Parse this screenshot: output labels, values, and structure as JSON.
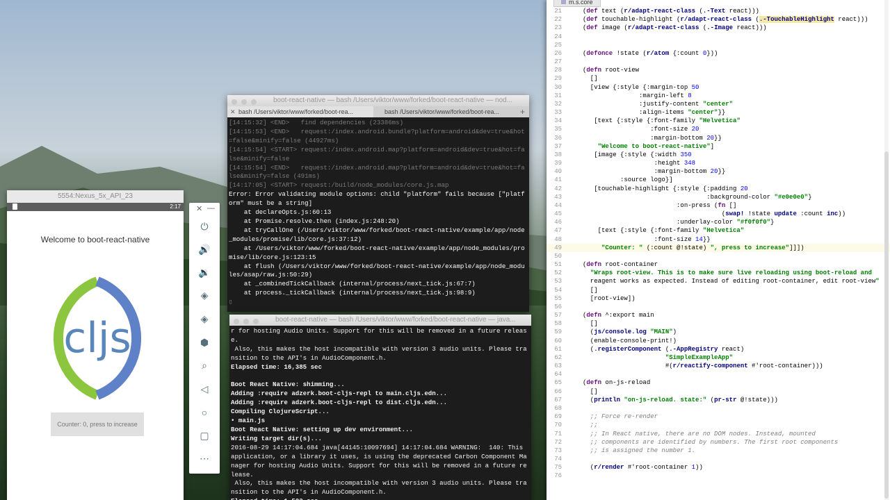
{
  "emulator": {
    "window_title": "5554:Nexus_5x_API_23",
    "status_time": "2:17",
    "welcome_text": "Welcome to boot-react-native",
    "logo_text": "cljs",
    "counter_button": "Counter: 0, press to increase",
    "logo_colors": {
      "green": "#8cc63f",
      "blue": "#5e81c7",
      "text": "#5a87bb"
    }
  },
  "emulator_toolbar": {
    "close": "✕",
    "minimize": "—",
    "icons": [
      "power-icon",
      "volume-up-icon",
      "volume-down-icon",
      "rotate-left-icon",
      "rotate-right-icon",
      "camera-icon",
      "zoom-icon",
      "back-icon",
      "home-icon",
      "overview-icon",
      "more-icon"
    ],
    "glyphs": [
      "⏻",
      "🔊",
      "🔉",
      "◈",
      "◈",
      "⬢",
      "⌕",
      "◁",
      "○",
      "▢",
      "⋯"
    ]
  },
  "terminal1": {
    "title": "boot-react-native — bash  /Users/viktor/www/forked/boot-react-native — nod...",
    "tabs": [
      "bash  /Users/viktor/www/forked/boot-rea...",
      "bash  /Users/viktor/www/forked/boot-rea..."
    ],
    "lines": [
      {
        "text": "[14:15:32] <END>   find dependencies (23386ms)",
        "cls": ""
      },
      {
        "text": "[14:15:53] <END>   request:/index.android.bundle?platform=android&dev=true&hot=false&minify=false (44927ms)",
        "cls": ""
      },
      {
        "text": "[14:15:54] <START> request:/index.android.map?platform=android&dev=true&hot=false&minify=false",
        "cls": ""
      },
      {
        "text": "[14:15:54] <END>   request:/index.android.map?platform=android&dev=true&hot=false&minify=false (491ms)",
        "cls": ""
      },
      {
        "text": "[14:17:05] <START> request:/build/node_modules/core.js.map",
        "cls": ""
      },
      {
        "text": "Error: Error validating module options: child \"platform\" fails because [\"platform\" must be a string]",
        "cls": "err"
      },
      {
        "text": "    at declareOpts.js:60:13",
        "cls": "err"
      },
      {
        "text": "    at Promise.resolve.then (index.js:248:20)",
        "cls": "err"
      },
      {
        "text": "    at tryCallOne (/Users/viktor/www/forked/boot-react-native/example/app/node_modules/promise/lib/core.js:37:12)",
        "cls": "err"
      },
      {
        "text": "    at /Users/viktor/www/forked/boot-react-native/example/app/node_modules/promise/lib/core.js:123:15",
        "cls": "err"
      },
      {
        "text": "    at flush (/Users/viktor/www/forked/boot-react-native/example/app/node_modules/asap/raw.js:50:29)",
        "cls": "err"
      },
      {
        "text": "    at _combinedTickCallback (internal/process/next_tick.js:67:7)",
        "cls": "err"
      },
      {
        "text": "    at process._tickCallback (internal/process/next_tick.js:98:9)",
        "cls": "err"
      },
      {
        "text": "▯",
        "cls": ""
      }
    ]
  },
  "terminal2": {
    "title": "boot-react-native — bash  /Users/viktor/www/forked/boot-react-native — java...",
    "lines": [
      {
        "text": "r for hosting Audio Units. Support for this will be removed in a future release.",
        "cls": "nb"
      },
      {
        "text": " Also, this makes the host incompatible with version 3 audio units. Please transition to the API's in AudioComponent.h.",
        "cls": "nb"
      },
      {
        "text": "Elapsed time: 16,385 sec",
        "cls": ""
      },
      {
        "text": " ",
        "cls": ""
      },
      {
        "text": "Boot React Native: shimming...",
        "cls": ""
      },
      {
        "text": "Adding :require adzerk.boot-cljs-repl to main.cljs.edn...",
        "cls": ""
      },
      {
        "text": "Adding :require adzerk.boot-cljs-repl to dist.cljs.edn...",
        "cls": ""
      },
      {
        "text": "Compiling ClojureScript...",
        "cls": ""
      },
      {
        "text": "• main.js",
        "cls": ""
      },
      {
        "text": "Boot React Native: setting up dev environment...",
        "cls": ""
      },
      {
        "text": "Writing target dir(s)...",
        "cls": ""
      },
      {
        "text": "2016-08-29 14:17:04.684 java[44145:10097694] 14:17:04.684 WARNING:  140: This application, or a library it uses, is using the deprecated Carbon Component Manager for hosting Audio Units. Support for this will be removed in a future release.",
        "cls": "nb"
      },
      {
        "text": " Also, this makes the host incompatible with version 3 audio units. Please transition to the API's in AudioComponent.h.",
        "cls": "nb"
      },
      {
        "text": "Elapsed time: 1,523 sec",
        "cls": ""
      }
    ]
  },
  "editor": {
    "tab": "m.s.core",
    "lines": [
      {
        "n": "21",
        "h": "(def text (r/adapt-react-class (.-Text react)))"
      },
      {
        "n": "22",
        "h": "(def touchable-highlight (r/adapt-react-class (.-TouchableHighlight react)))"
      },
      {
        "n": "23",
        "h": "(def image (r/adapt-react-class (.-Image react)))"
      },
      {
        "n": "24",
        "h": ""
      },
      {
        "n": "25",
        "h": ""
      },
      {
        "n": "26",
        "h": "(defonce !state (r/atom {:count 0}))"
      },
      {
        "n": "27",
        "h": ""
      },
      {
        "n": "28",
        "h": "(defn root-view"
      },
      {
        "n": "29",
        "h": "  []"
      },
      {
        "n": "30",
        "h": "  [view {:style {:margin-top 50"
      },
      {
        "n": "31",
        "h": "               :margin-left 8"
      },
      {
        "n": "32",
        "h": "               :justify-content \"center\""
      },
      {
        "n": "33",
        "h": "               :align-items \"center\"}}"
      },
      {
        "n": "34",
        "h": "   [text {:style {:font-family \"Helvetica\""
      },
      {
        "n": "35",
        "h": "                  :font-size 20"
      },
      {
        "n": "36",
        "h": "                  :margin-bottom 20}}"
      },
      {
        "n": "37",
        "h": "    \"Welcome to boot-react-native\"]"
      },
      {
        "n": "38",
        "h": "   [image {:style {:width 350"
      },
      {
        "n": "39",
        "h": "                   :height 348"
      },
      {
        "n": "40",
        "h": "                   :margin-bottom 20}}"
      },
      {
        "n": "41",
        "h": "          :source logo}]"
      },
      {
        "n": "42",
        "h": "   [touchable-highlight {:style {:padding 20"
      },
      {
        "n": "43",
        "h": "                                 :background-color \"#e0e0e0\"}"
      },
      {
        "n": "44",
        "h": "                         :on-press (fn []"
      },
      {
        "n": "45",
        "h": "                                     (swap! !state update :count inc))"
      },
      {
        "n": "46",
        "h": "                         :underlay-color \"#f0f0f0\"}"
      },
      {
        "n": "47",
        "h": "    [text {:style {:font-family \"Helvetica\""
      },
      {
        "n": "48",
        "h": "                   :font-size 14}}"
      },
      {
        "n": "49",
        "h": "     \"Counter: \" (:count @!state) \", press to increase\"]]])"
      },
      {
        "n": "50",
        "h": ""
      },
      {
        "n": "51",
        "h": "(defn root-container"
      },
      {
        "n": "52",
        "h": "  \"Wraps root-view. This is to make sure live reloading using boot-reload and"
      },
      {
        "n": "53",
        "h": "  reagent works as expected. Instead of editing root-container, edit root-view\""
      },
      {
        "n": "54",
        "h": "  []"
      },
      {
        "n": "55",
        "h": "  [root-view])"
      },
      {
        "n": "56",
        "h": ""
      },
      {
        "n": "57",
        "h": "(defn ^:export main"
      },
      {
        "n": "58",
        "h": "  []"
      },
      {
        "n": "59",
        "h": "  (js/console.log \"MAIN\")"
      },
      {
        "n": "60",
        "h": "  (enable-console-print!)"
      },
      {
        "n": "61",
        "h": "  (.registerComponent (.-AppRegistry react)"
      },
      {
        "n": "62",
        "h": "                      \"SimpleExampleApp\""
      },
      {
        "n": "63",
        "h": "                      #(r/reactify-component #'root-container)))"
      },
      {
        "n": "64",
        "h": ""
      },
      {
        "n": "65",
        "h": "(defn on-js-reload"
      },
      {
        "n": "66",
        "h": "  []"
      },
      {
        "n": "67",
        "h": "  (println \"on-js-reload. state:\" (pr-str @!state)))"
      },
      {
        "n": "68",
        "h": ""
      },
      {
        "n": "69",
        "h": "  ;; Force re-render"
      },
      {
        "n": "70",
        "h": "  ;;"
      },
      {
        "n": "71",
        "h": "  ;; In React native, there are no DOM nodes. Instead, mounted"
      },
      {
        "n": "72",
        "h": "  ;; components are identified by numbers. The first root components"
      },
      {
        "n": "73",
        "h": "  ;; is assigned the number 1."
      },
      {
        "n": "74",
        "h": ""
      },
      {
        "n": "75",
        "h": "  (r/render #'root-container 1))"
      },
      {
        "n": "76",
        "h": ""
      }
    ],
    "current_line": "49",
    "colors": {
      "string": "#008000",
      "keyword_ns": "#000080",
      "number": "#0000ff",
      "comment": "#808080"
    }
  }
}
